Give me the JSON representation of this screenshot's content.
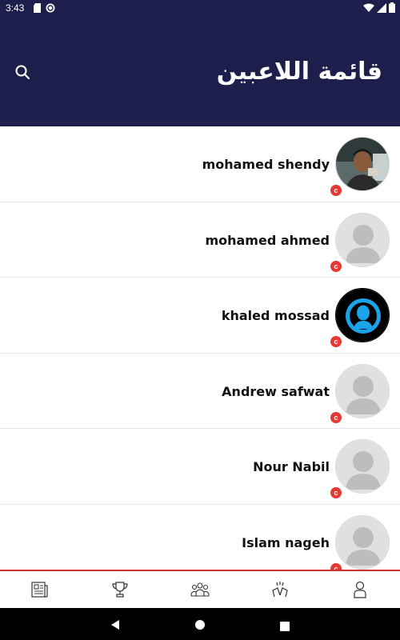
{
  "status_bar": {
    "time": "3:43",
    "icons": [
      "sd-card-icon",
      "sync-icon",
      "wifi-icon",
      "signal-icon",
      "battery-icon"
    ]
  },
  "header": {
    "title": "قائمة اللاعبين",
    "search_icon": "search-icon",
    "background_color": "#1e1e4c"
  },
  "players": [
    {
      "name": "mohamed shendy",
      "avatar": "photo",
      "badge": "c"
    },
    {
      "name": "mohamed ahmed",
      "avatar": "placeholder",
      "badge": "c"
    },
    {
      "name": "khaled mossad",
      "avatar": "silhouette-blue",
      "badge": "c"
    },
    {
      "name": "Andrew safwat",
      "avatar": "placeholder",
      "badge": "c"
    },
    {
      "name": "Nour Nabil",
      "avatar": "placeholder",
      "badge": "c"
    },
    {
      "name": "Islam nageh",
      "avatar": "placeholder",
      "badge": "c"
    }
  ],
  "bottom_nav": {
    "items": [
      "news-icon",
      "trophy-icon",
      "team-icon",
      "cheers-icon",
      "profile-icon"
    ],
    "active_index": 2,
    "accent_color": "#d32f2f"
  },
  "system_nav": [
    "back-icon",
    "home-icon",
    "recents-icon"
  ]
}
